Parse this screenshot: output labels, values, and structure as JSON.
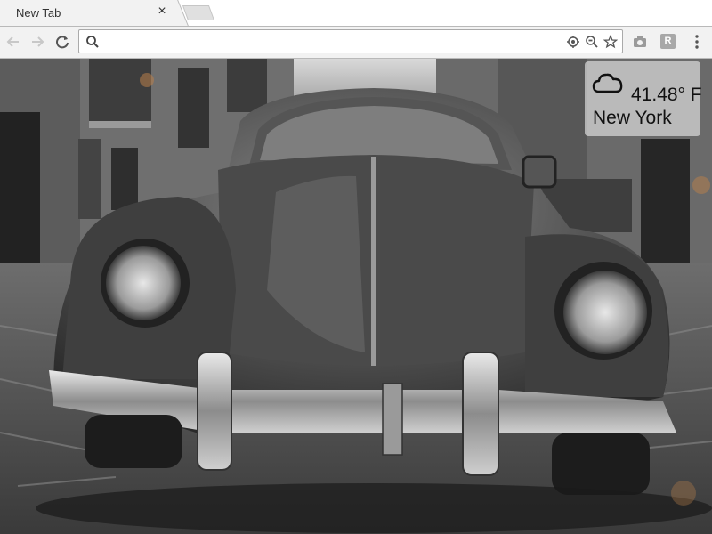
{
  "browser": {
    "tab": {
      "title": "New Tab",
      "close_glyph": "×"
    },
    "toolbar": {
      "back_icon": "arrow-left-icon",
      "forward_icon": "arrow-right-icon",
      "reload_icon": "reload-icon",
      "omnibox": {
        "value": "",
        "placeholder": ""
      },
      "extension_r_label": "R"
    }
  },
  "weather": {
    "condition_icon": "cloud-icon",
    "temperature": "41.48° F",
    "city": "New York"
  },
  "colors": {
    "tab_bg": "#f2f2f2",
    "toolbar_bg": "#f2f2f2",
    "border": "#b9b9b9",
    "widget_bg": "#ebebeb"
  }
}
